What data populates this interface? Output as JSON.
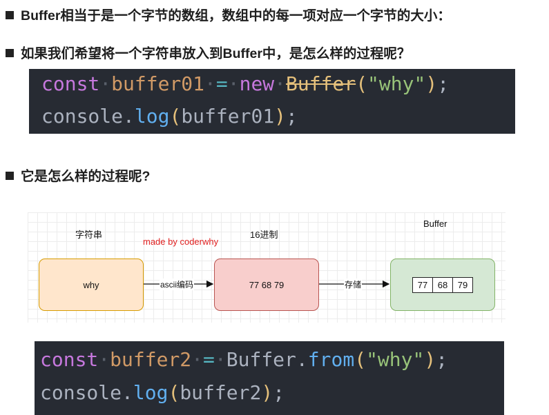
{
  "bullets": [
    "Buffer相当于是一个字节的数组，数组中的每一项对应一个字节的大小：",
    "如果我们希望将一个字符串放入到Buffer中，是怎么样的过程呢？",
    "它是怎么样的过程呢?"
  ],
  "code1": {
    "line1": {
      "kw": "const",
      "name": "buffer01",
      "eq": "=",
      "new": "new",
      "cls": "Buffer",
      "open": "(",
      "arg": "\"why\"",
      "close": ")",
      "semi": ";"
    },
    "line2": {
      "obj": "console",
      "dot": ".",
      "fn": "log",
      "open": "(",
      "arg": "buffer01",
      "close": ")",
      "semi": ";"
    }
  },
  "diagram": {
    "col_labels": {
      "string": "字符串",
      "hex": "16进制",
      "buffer": "Buffer"
    },
    "watermark": "made by coderwhy",
    "boxes": {
      "string": "why",
      "hex": "77 68 79"
    },
    "buffer_cells": [
      "77",
      "68",
      "79"
    ],
    "arrows": {
      "encode": "ascii编码",
      "store": "存储"
    },
    "colors": {
      "string_fill": "#ffe6cc",
      "string_border": "#d79b00",
      "hex_fill": "#f8cecc",
      "hex_border": "#b85450",
      "buffer_fill": "#d5e8d4",
      "buffer_border": "#82b366",
      "watermark": "#e02020"
    }
  },
  "code2": {
    "line1": {
      "kw": "const",
      "name": "buffer2",
      "eq": "=",
      "cls": "Buffer",
      "dot": ".",
      "fn": "from",
      "open": "(",
      "arg": "\"why\"",
      "close": ")",
      "semi": ";"
    },
    "line2": {
      "obj": "console",
      "dot": ".",
      "fn": "log",
      "open": "(",
      "arg": "buffer2",
      "close": ")",
      "semi": ";"
    }
  },
  "theme": {
    "code_bg": "#272b33",
    "keyword": "#c678dd",
    "variable": "#d19a66",
    "function": "#61afef",
    "string": "#98c379",
    "class": "#e5c07b"
  }
}
